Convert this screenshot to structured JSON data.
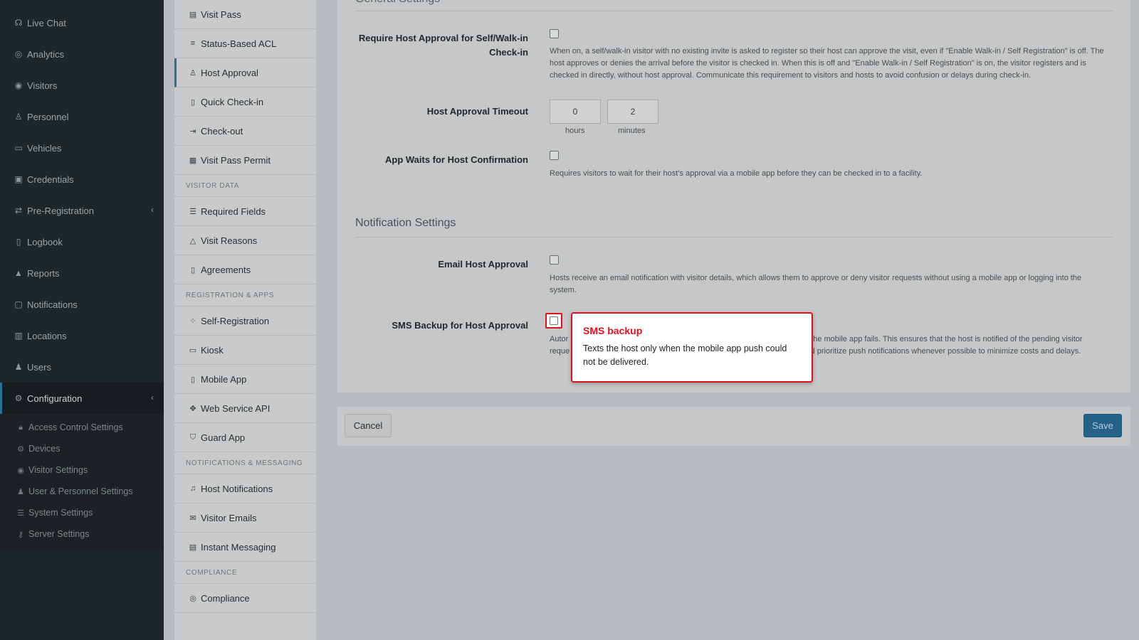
{
  "sidebar": {
    "items": [
      {
        "label": "Live Chat",
        "icon": "headset-icon"
      },
      {
        "label": "Analytics",
        "icon": "target-icon"
      },
      {
        "label": "Visitors",
        "icon": "eye-icon"
      },
      {
        "label": "Personnel",
        "icon": "user-badge-icon"
      },
      {
        "label": "Vehicles",
        "icon": "car-icon"
      },
      {
        "label": "Credentials",
        "icon": "id-card-icon"
      },
      {
        "label": "Pre-Registration",
        "icon": "arrows-icon",
        "chevron": "‹"
      },
      {
        "label": "Logbook",
        "icon": "book-icon"
      },
      {
        "label": "Reports",
        "icon": "chart-icon"
      },
      {
        "label": "Notifications",
        "icon": "chat-icon"
      },
      {
        "label": "Locations",
        "icon": "building-icon"
      },
      {
        "label": "Users",
        "icon": "users-icon"
      },
      {
        "label": "Configuration",
        "icon": "gear-icon",
        "chevron": "‹"
      }
    ],
    "sub_items": [
      {
        "label": "Access Control Settings",
        "icon": "lock-icon"
      },
      {
        "label": "Devices",
        "icon": "gear-icon"
      },
      {
        "label": "Visitor Settings",
        "icon": "eye-icon"
      },
      {
        "label": "User & Personnel Settings",
        "icon": "users-icon"
      },
      {
        "label": "System Settings",
        "icon": "sliders-icon"
      },
      {
        "label": "Server Settings",
        "icon": "key-icon"
      }
    ]
  },
  "submenu": {
    "group1": [
      {
        "label": "Visit Pass",
        "icon": "ticket-icon"
      },
      {
        "label": "Status-Based ACL",
        "icon": "list-check-icon"
      },
      {
        "label": "Host Approval",
        "icon": "user-check-icon"
      },
      {
        "label": "Quick Check-in",
        "icon": "door-icon"
      },
      {
        "label": "Check-out",
        "icon": "exit-icon"
      },
      {
        "label": "Visit Pass Permit",
        "icon": "permit-icon"
      }
    ],
    "head_visitor_data": "VISITOR DATA",
    "group2": [
      {
        "label": "Required Fields",
        "icon": "checklist-icon"
      },
      {
        "label": "Visit Reasons",
        "icon": "shapes-icon"
      },
      {
        "label": "Agreements",
        "icon": "document-icon"
      }
    ],
    "head_registration": "REGISTRATION & APPS",
    "group3": [
      {
        "label": "Self-Registration",
        "icon": "grid-icon"
      },
      {
        "label": "Kiosk",
        "icon": "monitor-icon"
      },
      {
        "label": "Mobile App",
        "icon": "phone-icon"
      },
      {
        "label": "Web Service API",
        "icon": "network-icon"
      },
      {
        "label": "Guard App",
        "icon": "shield-icon"
      }
    ],
    "head_notifications": "NOTIFICATIONS & MESSAGING",
    "group4": [
      {
        "label": "Host Notifications",
        "icon": "bell-icon"
      },
      {
        "label": "Visitor Emails",
        "icon": "envelope-icon"
      },
      {
        "label": "Instant Messaging",
        "icon": "message-icon"
      }
    ],
    "head_compliance": "COMPLIANCE",
    "group5": [
      {
        "label": "Compliance",
        "icon": "badge-icon"
      }
    ]
  },
  "main": {
    "general_heading": "General Settings",
    "require_label": "Require Host Approval for Self/Walk-in Check-in",
    "require_help": "When on, a self/walk-in visitor with no existing invite is asked to register so their host can approve the visit, even if \"Enable Walk-in / Self Registration\" is off. The host approves or denies the arrival before the visitor is checked in. When this is off and \"Enable Walk-in / Self Registration\" is on, the visitor registers and is checked in directly, without host approval. Communicate this requirement to visitors and hosts to avoid confusion or delays during check-in.",
    "timeout_label": "Host Approval Timeout",
    "timeout_hours": "0",
    "timeout_minutes": "2",
    "hours_unit": "hours",
    "minutes_unit": "minutes",
    "appwait_label": "App Waits for Host Confirmation",
    "appwait_help": "Requires visitors to wait for their host's approval via a mobile app before they can be checked in to a facility.",
    "notification_heading": "Notification Settings",
    "email_label": "Email Host Approval",
    "email_help": "Hosts receive an email notification with visitor details, which allows them to approve or deny visitor requests without using a mobile app or logging into the system.",
    "sms_label": "SMS Backup for Host Approval",
    "sms_help_left_1": "Autor",
    "sms_help_left_2": "reque",
    "sms_help_right_1": "o the mobile app fails. This ensures that the host is notified of the pending visitor",
    "sms_help_right_2": "uld prioritize push notifications whenever possible to minimize costs and delays."
  },
  "footer": {
    "cancel": "Cancel",
    "save": "Save"
  },
  "tooltip": {
    "title": "SMS backup",
    "body": "Texts the host only when the mobile app push could not be delivered."
  },
  "colors": {
    "accent": "#2d6f96",
    "highlight": "#e0111d"
  }
}
